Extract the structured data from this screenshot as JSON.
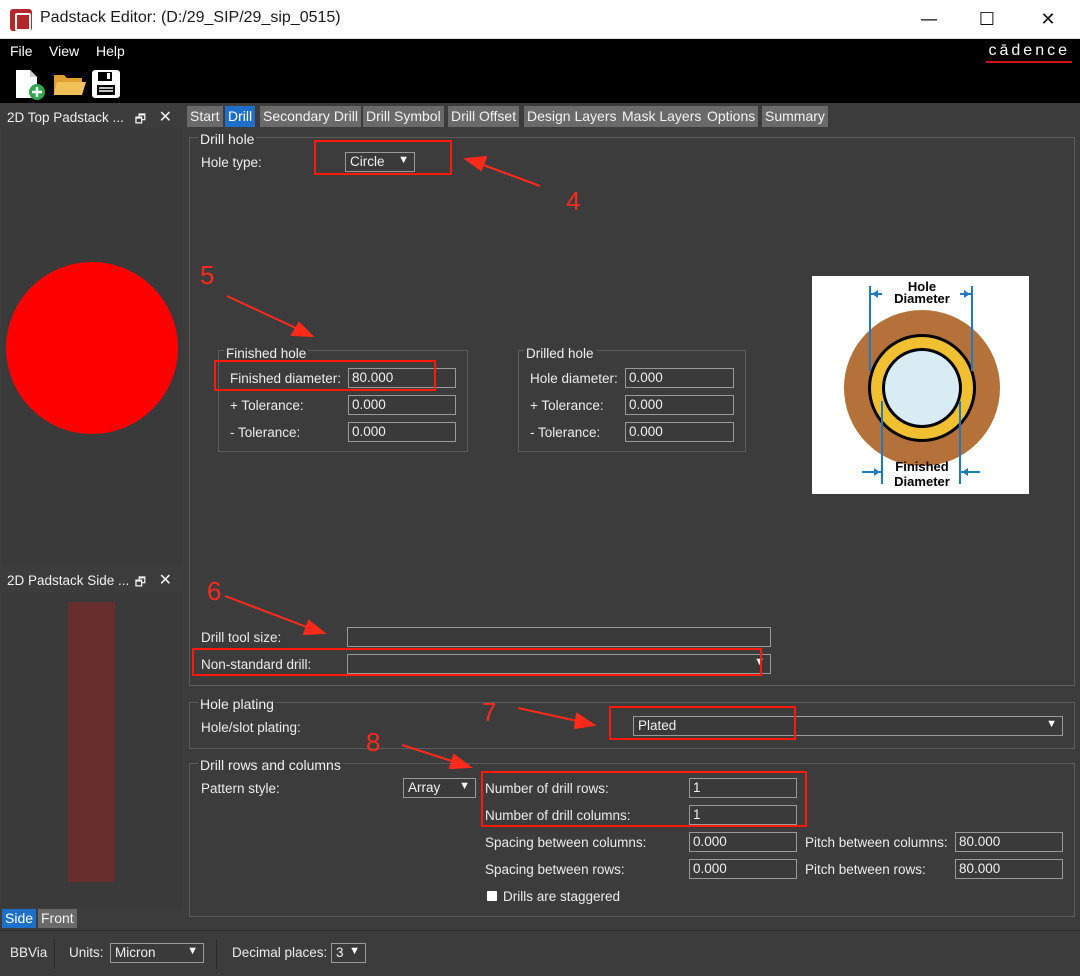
{
  "window": {
    "title": "Padstack Editor:  (D:/29_SIP/29_sip_0515)"
  },
  "menu": {
    "file": "File",
    "view": "View",
    "help": "Help",
    "brand": "cādence"
  },
  "panes": {
    "top_view": {
      "title": "2D Top Padstack ...",
      "pin": "🗗",
      "close": "✕"
    },
    "side_view": {
      "title": "2D Padstack Side ...",
      "pin": "🗗",
      "close": "✕"
    },
    "view_tabs": [
      {
        "label": "Side",
        "active": true
      },
      {
        "label": "Front",
        "active": false
      }
    ]
  },
  "tabs": [
    {
      "label": "Start",
      "active": false
    },
    {
      "label": "Drill",
      "active": true
    },
    {
      "label": "Secondary Drill",
      "active": false
    },
    {
      "label": "Drill Symbol",
      "active": false
    },
    {
      "label": "Drill Offset",
      "active": false
    },
    {
      "label": "Design Layers",
      "active": false
    },
    {
      "label": "Mask Layers",
      "active": false
    },
    {
      "label": "Options",
      "active": false
    },
    {
      "label": "Summary",
      "active": false
    }
  ],
  "drill_hole": {
    "title": "Drill hole",
    "hole_type_label": "Hole type:",
    "hole_type_value": "Circle",
    "finished": {
      "title": "Finished hole",
      "diameter_label": "Finished diameter:",
      "diameter_value": "80.000",
      "plus_tol_label": "+ Tolerance:",
      "plus_tol_value": "0.000",
      "minus_tol_label": "- Tolerance:",
      "minus_tol_value": "0.000"
    },
    "drilled": {
      "title": "Drilled hole",
      "diameter_label": "Hole diameter:",
      "diameter_value": "0.000",
      "plus_tol_label": "+ Tolerance:",
      "plus_tol_value": "0.000",
      "minus_tol_label": "- Tolerance:",
      "minus_tol_value": "0.000"
    },
    "diagram": {
      "top_label_1": "Hole",
      "top_label_2": "Diameter",
      "bottom_label_1": "Finished",
      "bottom_label_2": "Diameter"
    },
    "drill_tool_size_label": "Drill tool size:",
    "drill_tool_size_value": "",
    "non_standard_label": "Non-standard drill:",
    "non_standard_value": ""
  },
  "hole_plating": {
    "title": "Hole plating",
    "label": "Hole/slot plating:",
    "value": "Plated"
  },
  "drill_rows": {
    "title": "Drill rows and columns",
    "pattern_label": "Pattern style:",
    "pattern_value": "Array",
    "rows_label": "Number of drill rows:",
    "rows_value": "1",
    "cols_label": "Number of drill columns:",
    "cols_value": "1",
    "spacing_cols_label": "Spacing between columns:",
    "spacing_cols_value": "0.000",
    "spacing_rows_label": "Spacing between rows:",
    "spacing_rows_value": "0.000",
    "pitch_cols_label": "Pitch between columns:",
    "pitch_cols_value": "80.000",
    "pitch_rows_label": "Pitch between rows:",
    "pitch_rows_value": "80.000",
    "staggered_label": "Drills are staggered",
    "staggered_checked": false
  },
  "annotations": [
    "4",
    "5",
    "6",
    "7",
    "8"
  ],
  "status": {
    "padstack_name": "BBVia",
    "units_label": "Units:",
    "units_value": "Micron",
    "decimal_label": "Decimal places:",
    "decimal_value": "3"
  },
  "colors": {
    "accent": "#1e6fc8",
    "pad": "#ff0000",
    "annotation": "#ff2a1a",
    "copper": "#b5713a",
    "plating": "#f0c030",
    "hole": "#d8ecf4"
  }
}
